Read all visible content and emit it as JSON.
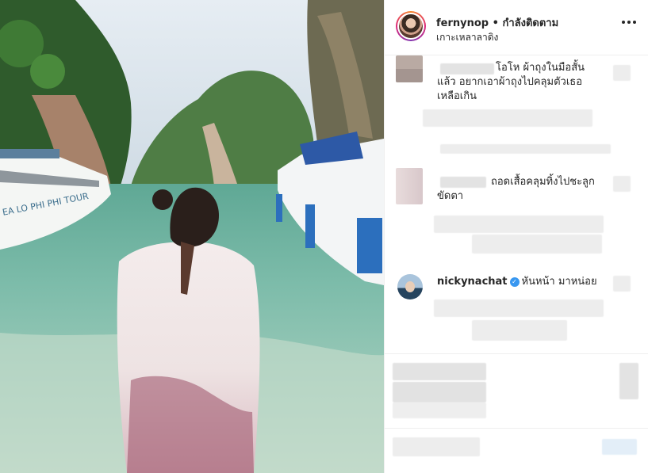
{
  "post": {
    "username": "fernynop",
    "separator": "•",
    "follow_status": "กำลังติดตาม",
    "location": "เกาะเหลาลาดิง",
    "more_icon": "more-icon"
  },
  "photo": {
    "boat_left_text": "EA LO PHI PHI TOUR"
  },
  "comments": [
    {
      "text_line1": "โอโห ผ้าถุงในมือสั้น",
      "text_line2": "แล้ว อยากเอาผ้าถุงไปคลุมตัวเธอ",
      "text_line3": "เหลือเกิน"
    },
    {
      "text_line1": "ถอดเสื้อคลุมทิ้งไปชะลูก",
      "text_line2": "ขัดตา"
    },
    {
      "username": "nickynachat",
      "verified_icon": "verified-icon",
      "text": "หันหน้า มาหน่อย"
    }
  ],
  "colors": {
    "verified": "#3897f0",
    "sea": "#74b7a6",
    "text": "#262626"
  }
}
